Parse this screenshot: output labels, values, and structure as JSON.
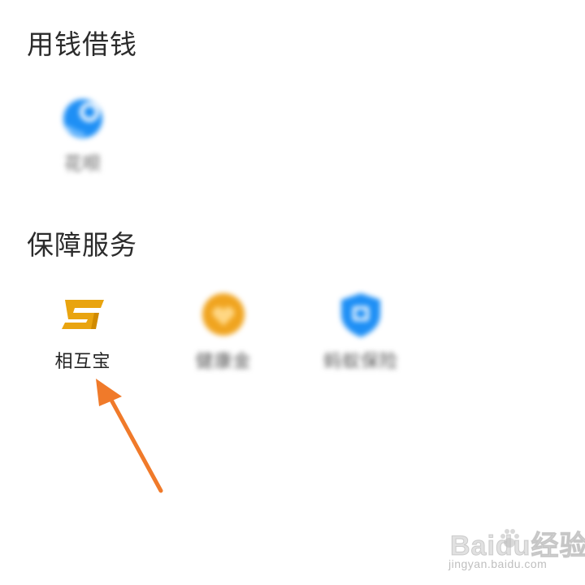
{
  "sections": [
    {
      "title": "用钱借钱",
      "items": [
        {
          "label": "花呗",
          "icon": "huabei-icon",
          "color": "#1e8ff5",
          "blurred": true
        }
      ]
    },
    {
      "title": "保障服务",
      "items": [
        {
          "label": "相互宝",
          "icon": "xianghubao-logo-icon",
          "color": "#e9a40f",
          "blurred": false
        },
        {
          "label": "健康金",
          "icon": "health-fund-icon",
          "color": "#f0a41f",
          "blurred": true
        },
        {
          "label": "蚂蚁保险",
          "icon": "shield-icon",
          "color": "#1e8ff5",
          "blurred": true
        }
      ]
    }
  ],
  "annotation": {
    "arrow_color": "#f07a2a",
    "target": "相互宝"
  },
  "watermark": {
    "brand": "Baidu经验",
    "url": "jingyan.baidu.com"
  }
}
